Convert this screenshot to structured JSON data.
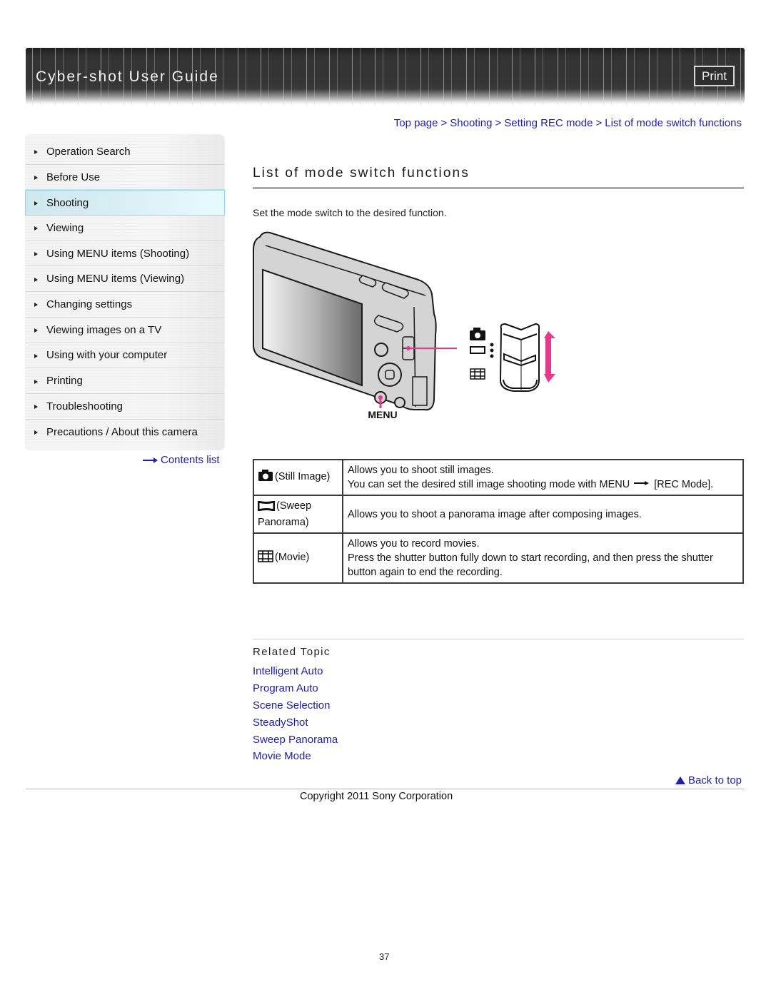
{
  "header": {
    "title": "Cyber-shot User Guide",
    "print_label": "Print"
  },
  "sidebar": {
    "items": [
      {
        "label": "Operation Search",
        "active": false
      },
      {
        "label": "Before Use",
        "active": false
      },
      {
        "label": "Shooting",
        "active": true
      },
      {
        "label": "Viewing",
        "active": false
      },
      {
        "label": "Using MENU items (Shooting)",
        "active": false
      },
      {
        "label": "Using MENU items (Viewing)",
        "active": false
      },
      {
        "label": "Changing settings",
        "active": false
      },
      {
        "label": "Viewing images on a TV",
        "active": false
      },
      {
        "label": "Using with your computer",
        "active": false
      },
      {
        "label": "Printing",
        "active": false
      },
      {
        "label": "Troubleshooting",
        "active": false
      },
      {
        "label": "Precautions / About this camera",
        "active": false
      }
    ],
    "contents_link": "Contents list"
  },
  "breadcrumb": {
    "items": [
      "Top page",
      "Shooting",
      "Setting REC mode",
      "List of mode switch functions"
    ],
    "separator": ">"
  },
  "main": {
    "title": "List of mode switch functions",
    "intro": "Set the mode switch to the desired function.",
    "illustration": {
      "menu_label": "MENU",
      "accent_color": "#e6398a",
      "switch_icons": [
        "camera-icon",
        "panorama-icon",
        "movie-film-icon"
      ]
    },
    "table": {
      "rows": [
        {
          "icon": "still-image-camera-icon",
          "mode": "(Still Image)",
          "line1": "Allows you to shoot still images.",
          "line2a": "You can set the desired still image shooting mode with MENU",
          "line2b": "[REC Mode]."
        },
        {
          "icon": "sweep-panorama-icon",
          "mode": "(Sweep Panorama)",
          "line1": "Allows you to shoot a panorama image after composing images."
        },
        {
          "icon": "movie-icon",
          "mode": "(Movie)",
          "line1": "Allows you to record movies.",
          "line2": "Press the shutter button fully down to start recording, and then press the shutter button again to end the recording."
        }
      ]
    },
    "related": {
      "title": "Related Topic",
      "links": [
        "Intelligent Auto",
        "Program Auto",
        "Scene Selection",
        "SteadyShot",
        "Sweep Panorama",
        "Movie Mode"
      ]
    }
  },
  "footer": {
    "back_to_top": "Back to top",
    "copyright": "Copyright 2011 Sony Corporation",
    "page_number": "37"
  },
  "colors": {
    "link": "#1f1fa8",
    "active_nav": "#d7eef3",
    "accent_pink": "#e6398a"
  }
}
